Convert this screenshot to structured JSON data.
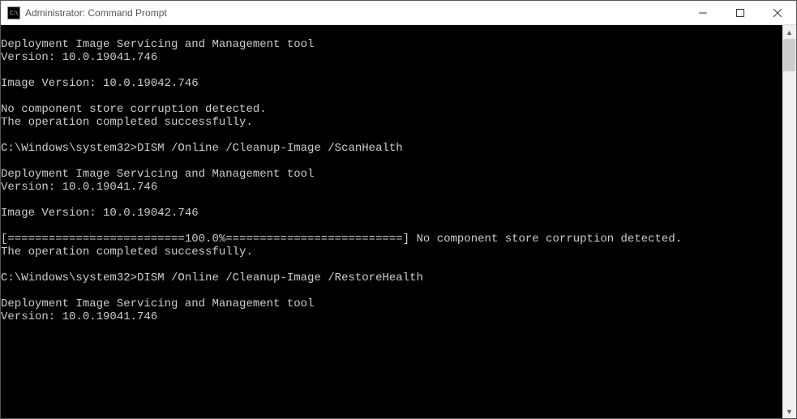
{
  "window": {
    "title": "Administrator: Command Prompt"
  },
  "console": {
    "lines": [
      "",
      "Deployment Image Servicing and Management tool",
      "Version: 10.0.19041.746",
      "",
      "Image Version: 10.0.19042.746",
      "",
      "No component store corruption detected.",
      "The operation completed successfully.",
      "",
      "C:\\Windows\\system32>DISM /Online /Cleanup-Image /ScanHealth",
      "",
      "Deployment Image Servicing and Management tool",
      "Version: 10.0.19041.746",
      "",
      "Image Version: 10.0.19042.746",
      "",
      "[==========================100.0%==========================] No component store corruption detected.",
      "The operation completed successfully.",
      "",
      "C:\\Windows\\system32>DISM /Online /Cleanup-Image /RestoreHealth",
      "",
      "Deployment Image Servicing and Management tool",
      "Version: 10.0.19041.746"
    ]
  }
}
